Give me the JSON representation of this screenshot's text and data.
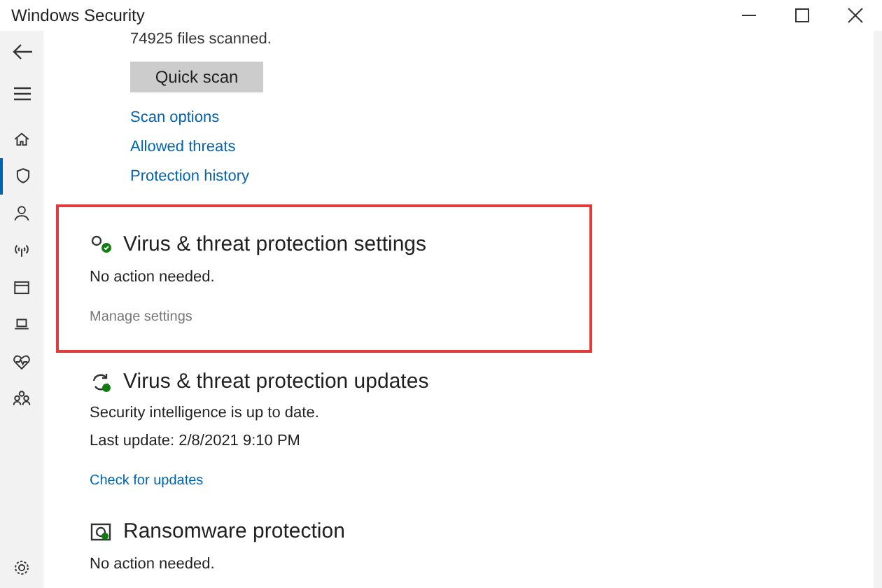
{
  "window": {
    "title": "Windows Security"
  },
  "sidebar": {
    "items": [
      {
        "selected": false
      },
      {
        "selected": true
      },
      {
        "selected": false
      },
      {
        "selected": false
      },
      {
        "selected": false
      },
      {
        "selected": false
      },
      {
        "selected": false
      },
      {
        "selected": false
      }
    ]
  },
  "scan": {
    "status": "74925 files scanned.",
    "button": "Quick scan",
    "links": [
      "Scan options",
      "Allowed threats",
      "Protection history"
    ]
  },
  "sections": [
    {
      "title": "Virus & threat protection settings",
      "lines": [
        "No action needed."
      ],
      "link": {
        "label": "Manage settings",
        "kind": "grey"
      },
      "highlighted": true
    },
    {
      "title": "Virus & threat protection updates",
      "lines": [
        "Security intelligence is up to date.",
        "Last update: 2/8/2021 9:10 PM"
      ],
      "link": {
        "label": "Check for updates",
        "kind": "blue"
      },
      "highlighted": false
    },
    {
      "title": "Ransomware protection",
      "lines": [
        "No action needed."
      ],
      "highlighted": false
    }
  ]
}
